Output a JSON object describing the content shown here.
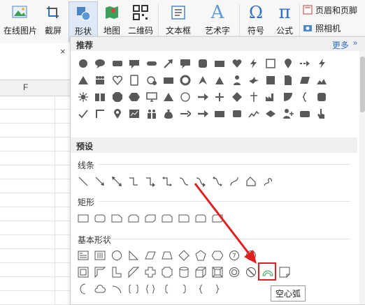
{
  "ribbon": {
    "buttons": [
      {
        "label": "在线图片",
        "icon": "online-picture-icon"
      },
      {
        "label": "截屏",
        "icon": "screenshot-icon"
      },
      {
        "label": "形状",
        "icon": "shapes-icon",
        "active": true
      },
      {
        "label": "地图",
        "icon": "map-icon"
      },
      {
        "label": "二维码",
        "icon": "qrcode-icon"
      },
      {
        "label": "文本框",
        "icon": "textbox-icon"
      },
      {
        "label": "艺术字",
        "icon": "wordart-icon"
      },
      {
        "label": "符号",
        "icon": "symbol-icon"
      },
      {
        "label": "公式",
        "icon": "formula-icon"
      }
    ],
    "header_footer": "页眉和页脚",
    "camera": "照相机",
    "glyph_art": "A",
    "glyph_symbol": "Ω",
    "glyph_formula": "π"
  },
  "sheet": {
    "column_label": "F",
    "close_glyph": "×"
  },
  "panel": {
    "recommended_title": "推荐",
    "more_label": "更多",
    "more_arrow": "»",
    "presets_title": "预设",
    "sections": {
      "lines": "线条",
      "rectangles": "矩形",
      "basic_shapes": "基本形状"
    },
    "tooltip": "空心弧",
    "highlight_color": "#e02020"
  },
  "colors": {
    "shape_fill": "#595959",
    "accent_green": "#3aa05a",
    "link_blue": "#2f6fc7"
  }
}
